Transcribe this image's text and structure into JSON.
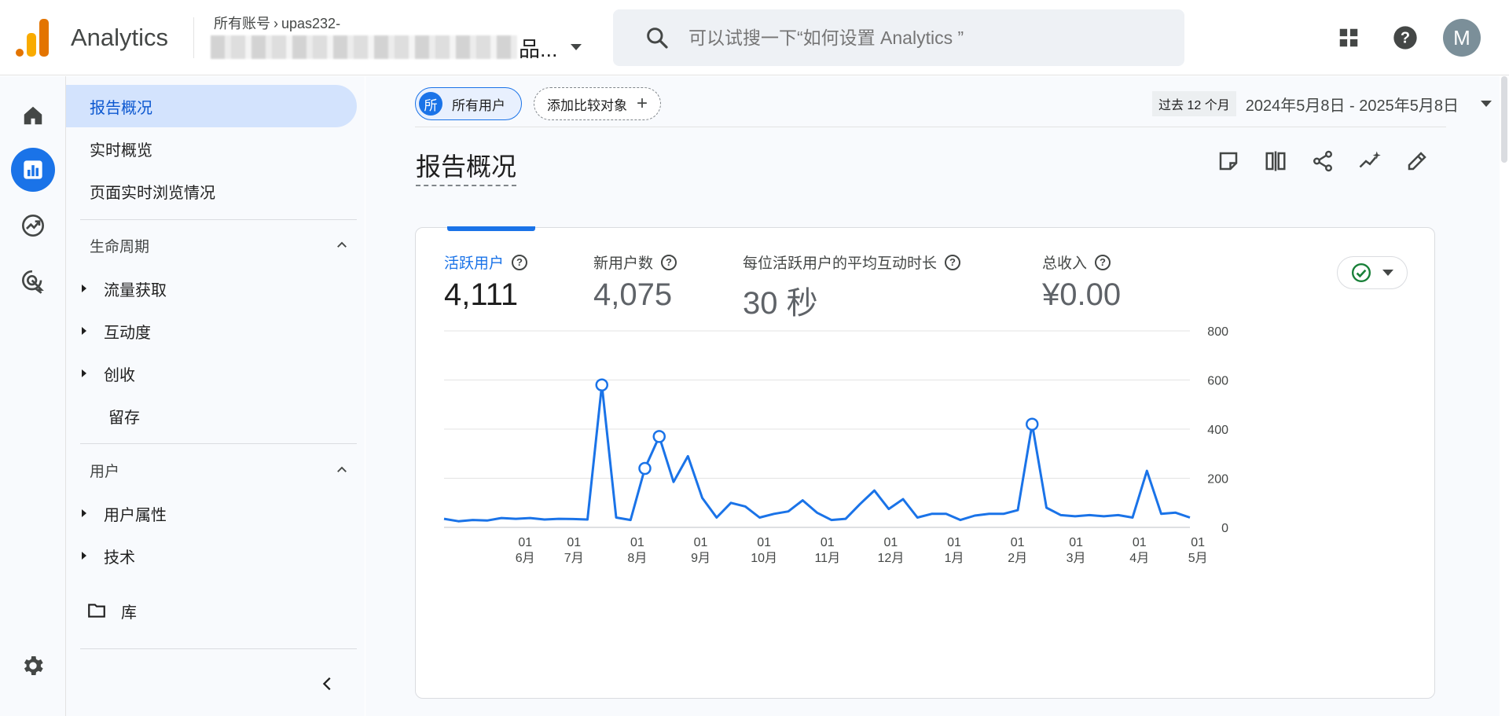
{
  "app": {
    "name": "Analytics"
  },
  "header": {
    "breadcrumb_account": "所有账号",
    "breadcrumb_property": "upas232-",
    "property_suffix": "品...",
    "search_placeholder": "可以试搜一下“如何设置 Analytics ”",
    "avatar_letter": "M"
  },
  "nav": {
    "reports_snapshot": "报告概况",
    "realtime_overview": "实时概览",
    "realtime_pages": "页面实时浏览情况",
    "lifecycle": {
      "title": "生命周期",
      "items": [
        "流量获取",
        "互动度",
        "创收",
        "留存"
      ]
    },
    "user": {
      "title": "用户",
      "items": [
        "用户属性",
        "技术"
      ]
    },
    "library": "库"
  },
  "filters": {
    "segment_badge": "所",
    "segment_label": "所有用户",
    "compare_label": "添加比较对象",
    "date_preset": "过去 12 个月",
    "date_range": "2024年5月8日 - 2025年5月8日"
  },
  "page": {
    "title": "报告概况"
  },
  "metrics": [
    {
      "label": "活跃用户",
      "value": "4,111",
      "active": true
    },
    {
      "label": "新用户数",
      "value": "4,075",
      "active": false
    },
    {
      "label": "每位活跃用户的平均互动时长",
      "value": "30 秒",
      "active": false
    },
    {
      "label": "总收入",
      "value": "¥0.00",
      "active": false
    }
  ],
  "colors": {
    "accent": "#1a73e8",
    "status_ok": "#188038"
  },
  "chart_data": {
    "type": "line",
    "series": [
      {
        "name": "活跃用户",
        "values": [
          35,
          25,
          30,
          28,
          38,
          35,
          38,
          32,
          35,
          34,
          32,
          580,
          40,
          30,
          240,
          370,
          185,
          290,
          120,
          40,
          100,
          85,
          40,
          55,
          65,
          110,
          60,
          30,
          35,
          95,
          150,
          75,
          115,
          40,
          55,
          55,
          30,
          48,
          55,
          55,
          70,
          420,
          80,
          50,
          45,
          50,
          45,
          50,
          40,
          230,
          55,
          60,
          40
        ]
      }
    ],
    "highlight_points": [
      11,
      14,
      15,
      41
    ],
    "x_ticks": [
      {
        "day": "01",
        "month": "6月"
      },
      {
        "day": "01",
        "month": "7月"
      },
      {
        "day": "01",
        "month": "8月"
      },
      {
        "day": "01",
        "month": "9月"
      },
      {
        "day": "01",
        "month": "10月"
      },
      {
        "day": "01",
        "month": "11月"
      },
      {
        "day": "01",
        "month": "12月"
      },
      {
        "day": "01",
        "month": "1月"
      },
      {
        "day": "01",
        "month": "2月"
      },
      {
        "day": "01",
        "month": "3月"
      },
      {
        "day": "01",
        "month": "4月"
      },
      {
        "day": "01",
        "month": "5月"
      }
    ],
    "y_ticks": [
      "800",
      "600",
      "400",
      "200",
      "0"
    ],
    "ylim": [
      0,
      800
    ],
    "grid": true
  }
}
